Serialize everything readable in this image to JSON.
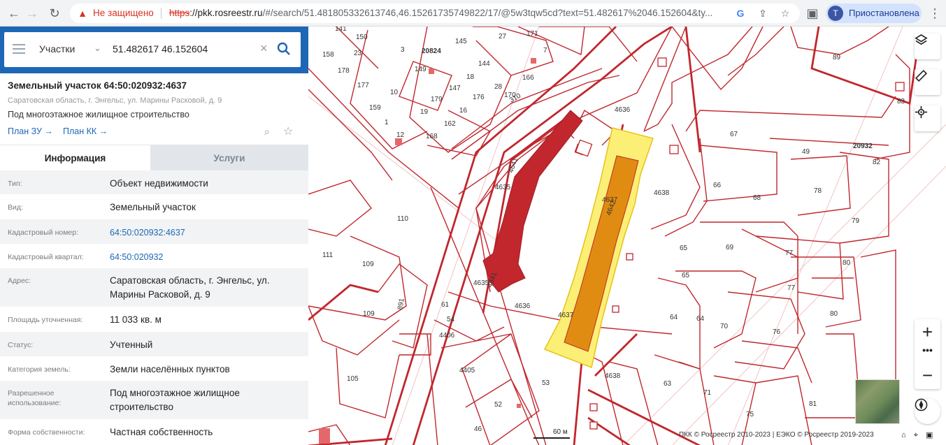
{
  "browser": {
    "security_label": "Не защищено",
    "url_scheme": "https",
    "url_host": "://pkk.rosreestr.ru",
    "url_rest": "/#/search/51.481805332613746,46.15261735749822/17/@5w3tqw5cd?text=51.482617%2046.152604&ty...",
    "profile_initial": "T",
    "profile_label": "Приостановлена"
  },
  "search": {
    "type": "Участки",
    "value": "51.482617 46.152604"
  },
  "parcel": {
    "title": "Земельный участок 64:50:020932:4637",
    "address": "Саратовская область, г. Энгельс, ул. Марины Расковой, д. 9",
    "use": "Под многоэтажное жилищное строительство",
    "plan_zu": "План ЗУ →",
    "plan_kk": "План КК →"
  },
  "tabs": {
    "info": "Информация",
    "services": "Услуги"
  },
  "info": [
    {
      "key": "Тип:",
      "value": "Объект недвижимости"
    },
    {
      "key": "Вид:",
      "value": "Земельный участок"
    },
    {
      "key": "Кадастровый номер:",
      "value": "64:50:020932:4637"
    },
    {
      "key": "Кадастровый квартал:",
      "value": "64:50:020932"
    },
    {
      "key": "Адрес:",
      "value": "Саратовская область, г. Энгельс, ул. Марины Расковой, д. 9"
    },
    {
      "key": "Площадь уточненная:",
      "value": "11 033 кв. м"
    },
    {
      "key": "Статус:",
      "value": "Учтенный"
    },
    {
      "key": "Категория земель:",
      "value": "Земли населённых пунктов"
    },
    {
      "key": "Разрешенное использование:",
      "value": "Под многоэтажное жилищное строительство"
    },
    {
      "key": "Форма собственности:",
      "value": "Частная собственность"
    }
  ],
  "map": {
    "scale": "60 м",
    "copyright": "ПКК © Росреестр 2010-2023 | ЕЭКО © Росреестр 2019-2023",
    "zoom_in": "+",
    "zoom_more": "•••",
    "zoom_out": "−",
    "labels": [
      "141",
      "150",
      "3",
      "20824",
      "145",
      "27",
      "171",
      "7",
      "158",
      "23",
      "149",
      "89",
      "178",
      "18",
      "144",
      "166",
      "177",
      "147",
      "28",
      "170",
      "10",
      "179",
      "176",
      "310",
      "159",
      "19",
      "16",
      "4636",
      "1",
      "162",
      "83",
      "12",
      "168",
      "67",
      "20932",
      "49",
      "82",
      "4641",
      "4635",
      "4637",
      "4642",
      "4638",
      "66",
      "78",
      "68",
      "110",
      "65",
      "79",
      "111",
      "109",
      "69",
      "77",
      "4635",
      "4641",
      "4636",
      "65",
      "891",
      "61",
      "77",
      "80",
      "109",
      "54",
      "4637",
      "64",
      "64",
      "70",
      "4406",
      "76",
      "80",
      "4405",
      "53",
      "4638",
      "105",
      "63",
      "71",
      "52",
      "75",
      "81",
      "46"
    ]
  }
}
